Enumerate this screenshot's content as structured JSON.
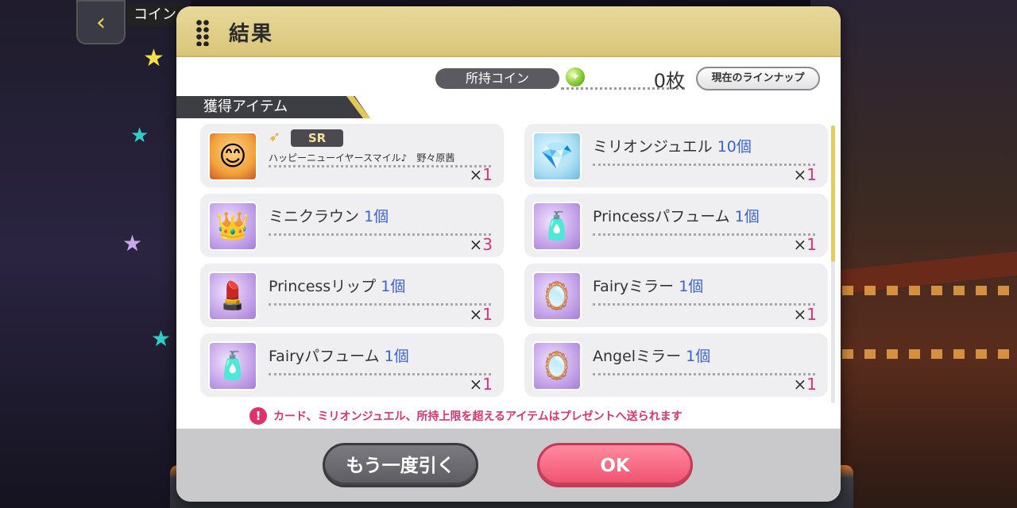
{
  "background": {
    "screen_title": "コイン",
    "back_icon": "chevron-left-icon"
  },
  "dialog": {
    "title": "結果",
    "coin": {
      "label": "所持コイン",
      "icon": "coin-gem-icon",
      "value": "0枚"
    },
    "lineup_button": "現在のラインナップ",
    "section_label": "獲得アイテム",
    "items": [
      {
        "kind": "card",
        "rarity": "SR",
        "card_name": "ハッピーニューイヤースマイル♪　野々原茜",
        "count_prefix": "×",
        "count": "1"
      },
      {
        "name": "ミリオンジュエル",
        "qty": "10個",
        "count_prefix": "×",
        "count": "1",
        "icon": "jewel-icon"
      },
      {
        "name": "ミニクラウン",
        "qty": "1個",
        "count_prefix": "×",
        "count": "3",
        "icon": "crown-icon"
      },
      {
        "name": "Princessパフューム",
        "qty": "1個",
        "count_prefix": "×",
        "count": "1",
        "icon": "perfume-icon"
      },
      {
        "name": "Princessリップ",
        "qty": "1個",
        "count_prefix": "×",
        "count": "1",
        "icon": "lipstick-icon"
      },
      {
        "name": "Fairyミラー",
        "qty": "1個",
        "count_prefix": "×",
        "count": "1",
        "icon": "mirror-icon"
      },
      {
        "name": "Fairyパフューム",
        "qty": "1個",
        "count_prefix": "×",
        "count": "1",
        "icon": "perfume-icon"
      },
      {
        "name": "Angelミラー",
        "qty": "1個",
        "count_prefix": "×",
        "count": "1",
        "icon": "mirror-icon"
      }
    ],
    "warning": "カード、ミリオンジュエル、所持上限を超えるアイテムはプレゼントへ送られます",
    "buttons": {
      "again": "もう一度引く",
      "ok": "OK"
    }
  },
  "colors": {
    "header_gold": "#d9c67a",
    "accent_pink": "#e0327a",
    "qty_blue": "#3a62d6",
    "ok_pink": "#f0506e"
  }
}
